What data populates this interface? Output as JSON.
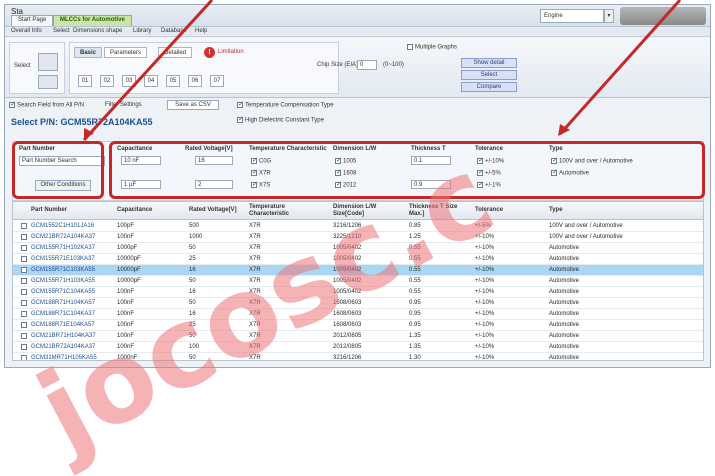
{
  "app": {
    "title": "Sta",
    "tabs": [
      "Start Page",
      "MLCCs for Automotive"
    ]
  },
  "engine": {
    "label": "Engine",
    "button": "▾"
  },
  "menu": [
    "Overall Info",
    "Select",
    "Dimensions shape",
    "Library",
    "Database",
    "Help"
  ],
  "ribbon": {
    "side_label": "Select",
    "tabs": [
      "Basic",
      "Parameters",
      "Detailed"
    ],
    "warn_label": "Limitation",
    "buttons": [
      "01",
      "02",
      "03",
      "04",
      "05",
      "06",
      "07"
    ],
    "chip_size_label": "Chip Size (EIA)",
    "chip_size_value": "0",
    "chip_size_unit": "(0~100)",
    "actions": [
      "Show detail",
      "Select",
      "Compare"
    ],
    "check_label": "Multiple Graphs"
  },
  "toolbar2": {
    "items": [
      "Search Field from All P/N",
      "Filter Settings",
      "Save as CSV"
    ],
    "right_items": [
      "Temperature Compensation Type",
      "High Dielectric Constant Type"
    ]
  },
  "part_fn": "Select P/N: GCM55R72A104KA55",
  "filters": {
    "part_number_label": "Part Number",
    "part_number_value": "Part Number Search",
    "other_conditions": "Other Conditions",
    "capacitance_label": "Capacitance",
    "capacitance_values": [
      "10 nF",
      "1 µF"
    ],
    "rated_voltage_label": "Rated Voltage[V]",
    "rated_voltage_values": [
      "16",
      "2"
    ],
    "temperature_label": "Temperature Characteristic",
    "temperature_items": [
      "C0G",
      "X7R",
      "X7S"
    ],
    "dimension_label": "Dimension L/W",
    "dimension_items": [
      "1005",
      "1608",
      "2012"
    ],
    "thickness_label": "Thickness T",
    "thickness_values": [
      "0.1",
      "0.9"
    ],
    "tolerance_label": "Tolerance",
    "tolerance_items": [
      "+/-10%",
      "+/-5%",
      "+/-1%"
    ],
    "type_label": "Type",
    "type_items": [
      "100V and over / Automotive",
      "Automotive"
    ]
  },
  "grid": {
    "columns": [
      "Part Number",
      "Capacitance",
      "Rated Voltage[V]",
      "Temperature Characteristic",
      "Dimension L/W Size[Code]",
      "Thickness T Size Max.]",
      "Tolerance",
      "Type"
    ],
    "rows": [
      [
        "GCM1552C1H101JA16",
        "100pF",
        "500",
        "X7R",
        "3216/1206",
        "0.85",
        "+/-5%",
        "100V and over / Automotive"
      ],
      [
        "GCM21BR72A104KA37",
        "100nF",
        "1000",
        "X7R",
        "3225/1210",
        "1.25",
        "+/-10%",
        "100V and over / Automotive"
      ],
      [
        "GCM155R71H102KA37",
        "1000pF",
        "50",
        "X7R",
        "1005/0402",
        "0.55",
        "+/-10%",
        "Automotive"
      ],
      [
        "GCM155R71E103KA37",
        "10000pF",
        "25",
        "X7R",
        "1005/0402",
        "0.55",
        "+/-10%",
        "Automotive"
      ],
      [
        "GCM155R71C103KA55",
        "10000pF",
        "16",
        "X7R",
        "1005/0402",
        "0.55",
        "+/-10%",
        "Automotive"
      ],
      [
        "GCM155R71H103KA55",
        "10000pF",
        "50",
        "X7R",
        "1005/0402",
        "0.55",
        "+/-10%",
        "Automotive"
      ],
      [
        "GCM155R71C104KA55",
        "100nF",
        "16",
        "X7R",
        "1005/0402",
        "0.55",
        "+/-10%",
        "Automotive"
      ],
      [
        "GCM188R71H104KA57",
        "100nF",
        "50",
        "X7R",
        "1608/0603",
        "0.95",
        "+/-10%",
        "Automotive"
      ],
      [
        "GCM188R71C104KA37",
        "100nF",
        "16",
        "X7R",
        "1608/0603",
        "0.95",
        "+/-10%",
        "Automotive"
      ],
      [
        "GCM188R71E104KA57",
        "100nF",
        "25",
        "X7R",
        "1608/0603",
        "0.95",
        "+/-10%",
        "Automotive"
      ],
      [
        "GCM21BR71H104KA37",
        "100nF",
        "50",
        "X7R",
        "2012/0805",
        "1.35",
        "+/-10%",
        "Automotive"
      ],
      [
        "GCM21BR72A104KA37",
        "100nF",
        "100",
        "X7R",
        "2012/0805",
        "1.35",
        "+/-10%",
        "Automotive"
      ],
      [
        "GCM31MR71H105KA55",
        "1000nF",
        "50",
        "X7R",
        "3216/1206",
        "1.30",
        "+/-10%",
        "Automotive"
      ]
    ],
    "selected_row": 4
  },
  "watermark": "jocosc.c"
}
